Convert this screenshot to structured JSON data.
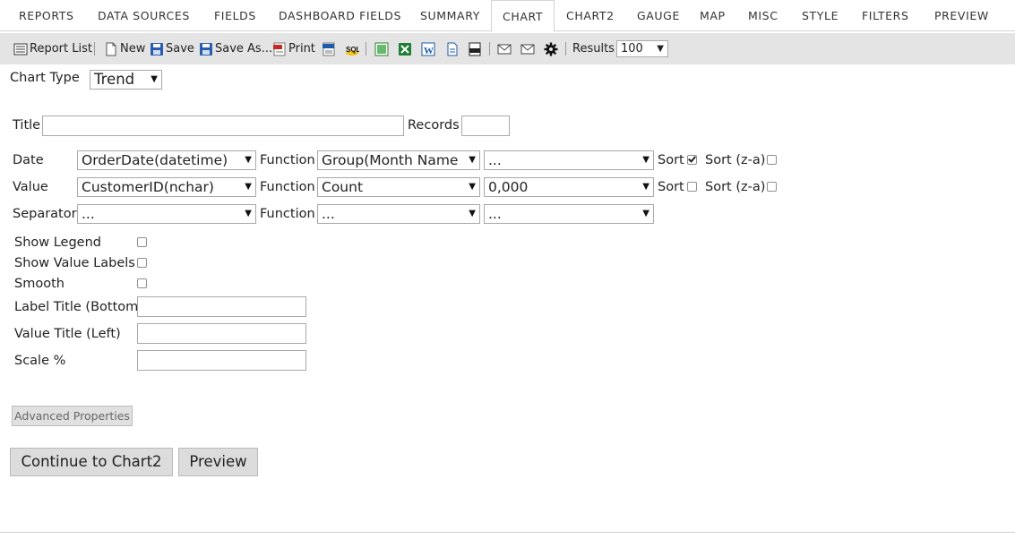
{
  "tabs": [
    {
      "label": "REPORTS"
    },
    {
      "label": "DATA SOURCES"
    },
    {
      "label": "FIELDS"
    },
    {
      "label": "DASHBOARD FIELDS"
    },
    {
      "label": "SUMMARY"
    },
    {
      "label": "CHART",
      "active": true
    },
    {
      "label": "CHART2"
    },
    {
      "label": "GAUGE"
    },
    {
      "label": "MAP"
    },
    {
      "label": "MISC"
    },
    {
      "label": "STYLE"
    },
    {
      "label": "FILTERS"
    },
    {
      "label": "PREVIEW"
    }
  ],
  "toolbar": {
    "report_list": "Report List",
    "new": "New",
    "save": "Save",
    "save_as": "Save As...",
    "print": "Print",
    "results_label": "Results",
    "results_value": "100"
  },
  "form": {
    "chart_type_label": "Chart Type",
    "chart_type_value": "Trend",
    "title_label": "Title",
    "records_label": "Records",
    "function_label": "Function",
    "sort_label": "Sort",
    "sort_za_label": "Sort (z-a)",
    "rows": [
      {
        "label": "Date",
        "field": "OrderDate(datetime)",
        "function": "Group(Month Name",
        "format": "...",
        "sort": true,
        "sort_za": false
      },
      {
        "label": "Value",
        "field": "CustomerID(nchar)",
        "function": "Count",
        "format": "0,000",
        "sort": false,
        "sort_za": false
      },
      {
        "label": "Separator",
        "field": "...",
        "function": "...",
        "format": "..."
      }
    ],
    "show_legend_label": "Show Legend",
    "show_value_labels_label": "Show Value Labels",
    "smooth_label": "Smooth",
    "label_title_bottom_label": "Label Title (Bottom)",
    "value_title_left_label": "Value Title (Left)",
    "scale_label": "Scale %"
  },
  "buttons": {
    "advanced": "Advanced Properties",
    "continue": "Continue to Chart2",
    "preview": "Preview"
  },
  "colors": {
    "toolbar_bg": "#e4e4e4",
    "button_bg": "#dcdcdc",
    "tab_border": "#d4d4d4"
  }
}
